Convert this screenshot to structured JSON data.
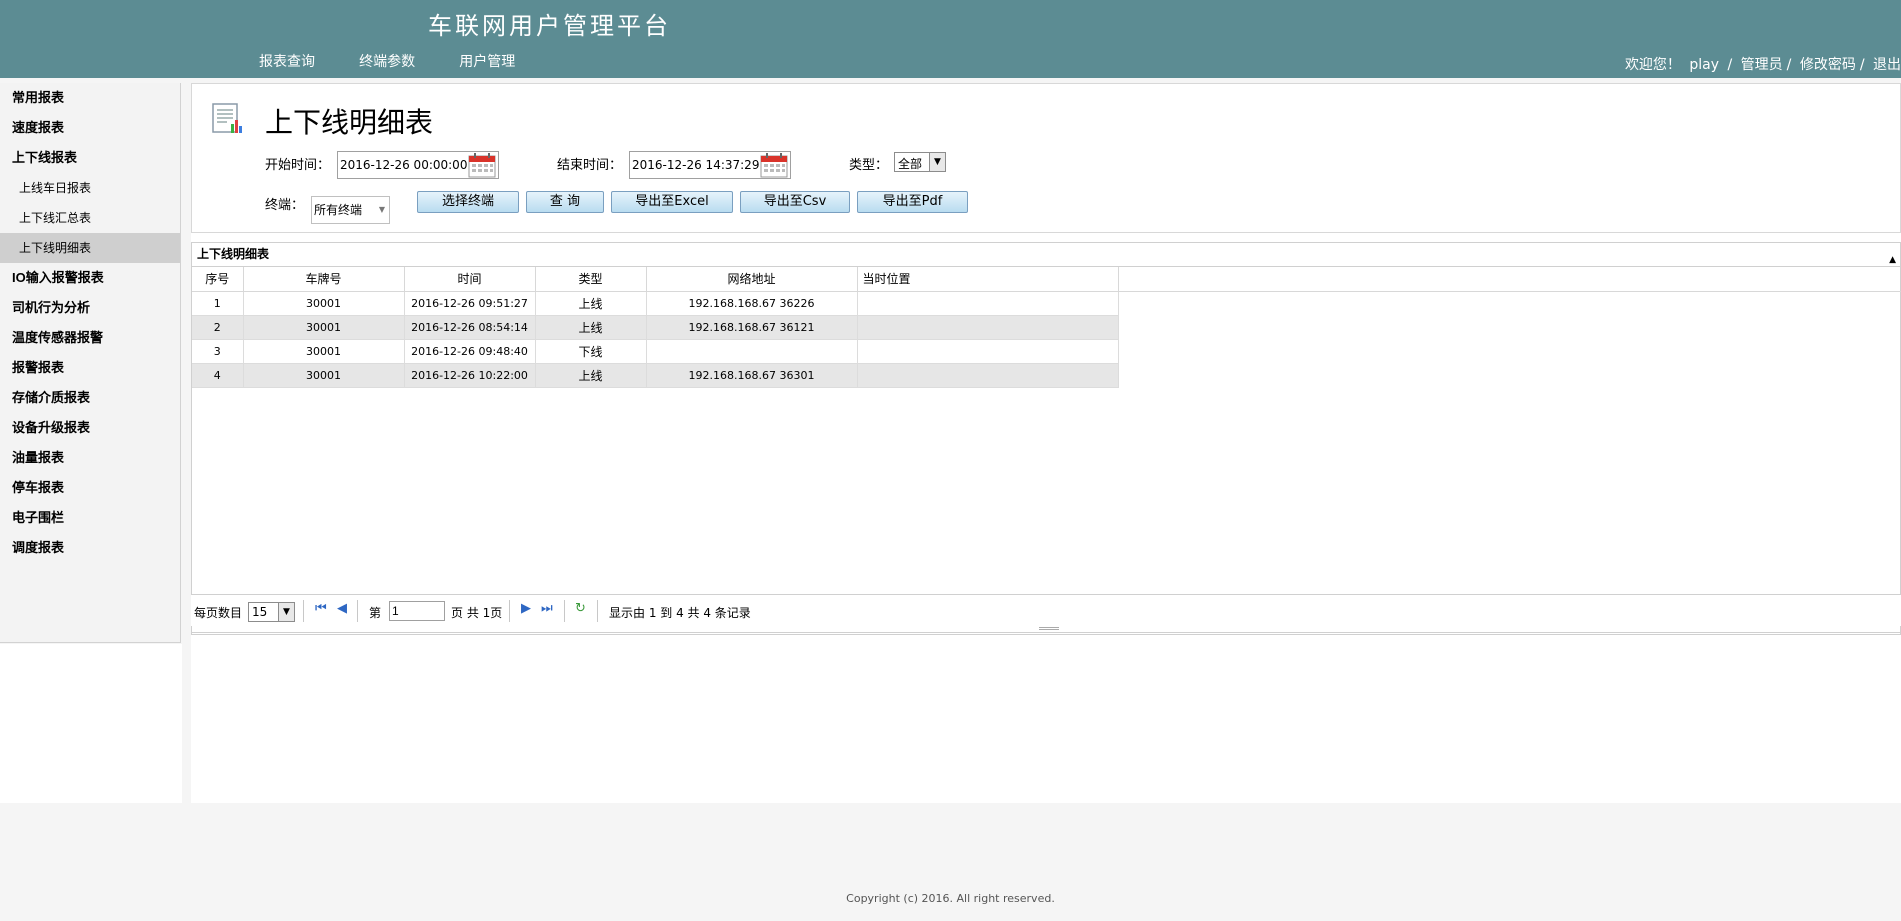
{
  "header": {
    "app_title": "车联网用户管理平台",
    "nav": [
      "报表查询",
      "终端参数",
      "用户管理"
    ],
    "welcome": "欢迎您！",
    "username": "play",
    "role": "管理员",
    "change_password": "修改密码",
    "logout": "退出",
    "sep": "/"
  },
  "sidebar": {
    "items": [
      {
        "label": "常用报表"
      },
      {
        "label": "速度报表"
      },
      {
        "label": "上下线报表"
      },
      {
        "label": "上线车日报表",
        "sub": true
      },
      {
        "label": "上下线汇总表",
        "sub": true
      },
      {
        "label": "上下线明细表",
        "sub": true,
        "active": true
      },
      {
        "label": "IO输入报警报表"
      },
      {
        "label": "司机行为分析"
      },
      {
        "label": "温度传感器报警"
      },
      {
        "label": "报警报表"
      },
      {
        "label": "存储介质报表"
      },
      {
        "label": "设备升级报表"
      },
      {
        "label": "油量报表"
      },
      {
        "label": "停车报表"
      },
      {
        "label": "电子围栏"
      },
      {
        "label": "调度报表"
      }
    ]
  },
  "query": {
    "title": "上下线明细表",
    "start_label": "开始时间：",
    "start_value": "2016-12-26 00:00:00",
    "end_label": "结束时间：",
    "end_value": "2016-12-26 14:37:29",
    "type_label": "类型：",
    "type_value": "全部",
    "terminal_label": "终端：",
    "terminal_value": "所有终端",
    "buttons": {
      "select_terminal": "选择终端",
      "search": "查 询",
      "export_excel": "导出至Excel",
      "export_csv": "导出至Csv",
      "export_pdf": "导出至Pdf"
    }
  },
  "grid": {
    "title": "上下线明细表",
    "columns": [
      "序号",
      "车牌号",
      "时间",
      "类型",
      "网络地址",
      "当时位置"
    ],
    "rows": [
      [
        "1",
        "30001",
        "2016-12-26 09:51:27",
        "上线",
        "192.168.168.67 36226",
        ""
      ],
      [
        "2",
        "30001",
        "2016-12-26 08:54:14",
        "上线",
        "192.168.168.67 36121",
        ""
      ],
      [
        "3",
        "30001",
        "2016-12-26 09:48:40",
        "下线",
        "",
        ""
      ],
      [
        "4",
        "30001",
        "2016-12-26 10:22:00",
        "上线",
        "192.168.168.67 36301",
        ""
      ]
    ]
  },
  "pager": {
    "page_size_label": "每页数目",
    "page_size": "15",
    "page_prefix": "第",
    "current_page": "1",
    "page_suffix": "页 共 1页",
    "summary": "显示由 1 到 4 共 4 条记录"
  },
  "footer": {
    "copyright": "Copyright (c) 2016. All right reserved."
  },
  "colors": {
    "header_bg": "#5c8c93",
    "button_border": "#7a9fc0",
    "active_item_bg": "#cfcfcf"
  }
}
